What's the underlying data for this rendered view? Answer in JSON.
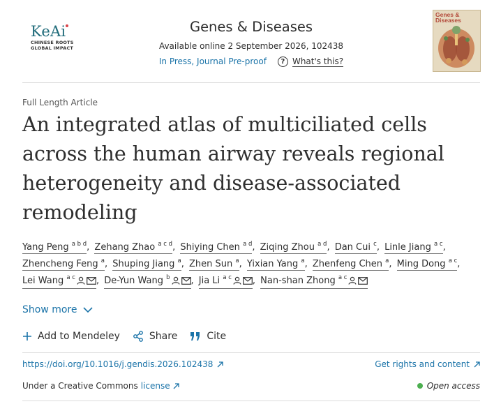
{
  "publisher": {
    "logo_text": "KeAi",
    "logo_line1": "CHINESE ROOTS",
    "logo_line2": "GLOBAL IMPACT"
  },
  "journal": {
    "title": "Genes & Diseases",
    "available": "Available online 2 September 2026, 102438",
    "status_link": "In Press, Journal Pre-proof",
    "whats_this": "What's this?",
    "cover_title_line1": "Genes &",
    "cover_title_line2": "Diseases"
  },
  "article": {
    "type": "Full Length Article",
    "title": "An integrated atlas of multiciliated cells across the human airway reveals regional heterogeneity and disease-associated remodeling"
  },
  "authors": [
    {
      "name": "Yang Peng",
      "aff": "a b d",
      "icons": []
    },
    {
      "name": "Zehang Zhao",
      "aff": "a c d",
      "icons": []
    },
    {
      "name": "Shiying Chen",
      "aff": "a d",
      "icons": []
    },
    {
      "name": "Ziqing Zhou",
      "aff": "a d",
      "icons": []
    },
    {
      "name": "Dan Cui",
      "aff": "c",
      "icons": []
    },
    {
      "name": "Linle Jiang",
      "aff": "a c",
      "icons": []
    },
    {
      "name": "Zhencheng Feng",
      "aff": "a",
      "icons": []
    },
    {
      "name": "Shuping Jiang",
      "aff": "a",
      "icons": []
    },
    {
      "name": "Zhen Sun",
      "aff": "a",
      "icons": []
    },
    {
      "name": "Yixian Yang",
      "aff": "a",
      "icons": []
    },
    {
      "name": "Zhenfeng Chen",
      "aff": "a",
      "icons": []
    },
    {
      "name": "Ming Dong",
      "aff": "a c",
      "icons": []
    },
    {
      "name": "Lei Wang",
      "aff": "a c",
      "icons": [
        "person-icon",
        "envelope-icon"
      ]
    },
    {
      "name": "De-Yun Wang",
      "aff": "b",
      "icons": [
        "person-icon",
        "envelope-icon"
      ]
    },
    {
      "name": "Jia Li",
      "aff": "a c",
      "icons": [
        "person-icon",
        "envelope-icon"
      ]
    },
    {
      "name": "Nan-shan Zhong",
      "aff": "a c",
      "icons": [
        "person-icon",
        "envelope-icon"
      ]
    }
  ],
  "show_more": "Show more",
  "actions": {
    "mendeley": "Add to Mendeley",
    "share": "Share",
    "cite": "Cite"
  },
  "links": {
    "doi": "https://doi.org/10.1016/j.gendis.2026.102438",
    "rights": "Get rights and content",
    "cc_prefix": "Under a Creative Commons",
    "cc_link": "license",
    "open_access": "Open access"
  },
  "colors": {
    "link": "#1a73a8",
    "open_access_dot": "#4caf50",
    "logo": "#1f6b7a"
  }
}
